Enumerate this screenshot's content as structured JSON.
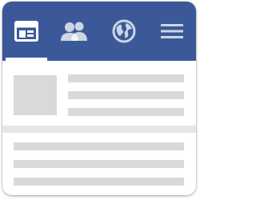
{
  "navbar": {
    "color": "#3b5998",
    "tabs": [
      {
        "id": "news-feed",
        "icon": "news-feed-icon",
        "active": true
      },
      {
        "id": "friends",
        "icon": "friends-icon",
        "active": false
      },
      {
        "id": "globe",
        "icon": "globe-icon",
        "active": false
      },
      {
        "id": "menu",
        "icon": "menu-icon",
        "active": false
      }
    ]
  },
  "feed": {
    "placeholder_color": "#d9d9d9",
    "post": {
      "kind": "placeholder-post"
    },
    "text_block": {
      "kind": "placeholder-text-lines"
    }
  }
}
